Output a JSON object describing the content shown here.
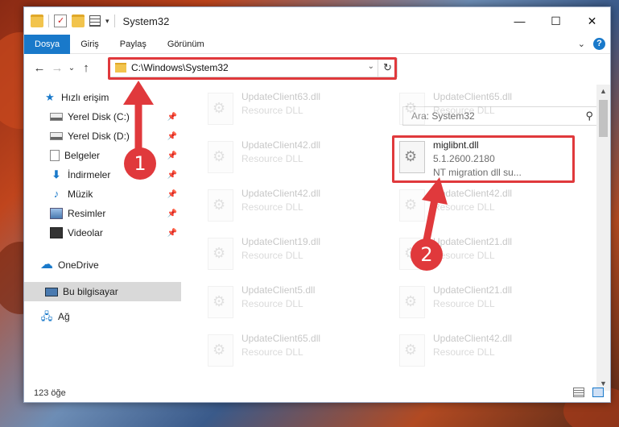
{
  "window": {
    "title": "System32",
    "controls": {
      "minimize": "—",
      "maximize": "☐",
      "close": "✕"
    }
  },
  "ribbon": {
    "tabs": [
      "Dosya",
      "Giriş",
      "Paylaş",
      "Görünüm"
    ],
    "active_tab": "Dosya",
    "collapse_icon": "chevron-down-icon",
    "help_label": "?"
  },
  "nav": {
    "back": "←",
    "forward": "→",
    "history": "⌄",
    "up": "↑",
    "address": "C:\\Windows\\System32",
    "refresh": "↻",
    "address_dropdown": "⌄",
    "search_placeholder": "Ara: System32",
    "search_icon": "⚲"
  },
  "sidebar": {
    "items": [
      {
        "label": "Hızlı erişim",
        "icon": "star-icon",
        "glyph": "★",
        "pinned": false
      },
      {
        "label": "Yerel Disk (C:)",
        "icon": "drive-icon",
        "glyph": "",
        "pinned": true
      },
      {
        "label": "Yerel Disk (D:)",
        "icon": "drive-icon",
        "glyph": "",
        "pinned": true
      },
      {
        "label": "Belgeler",
        "icon": "documents-icon",
        "glyph": "",
        "pinned": true
      },
      {
        "label": "İndirmeler",
        "icon": "download-icon",
        "glyph": "⬇",
        "pinned": true
      },
      {
        "label": "Müzik",
        "icon": "music-icon",
        "glyph": "♪",
        "pinned": true
      },
      {
        "label": "Resimler",
        "icon": "pictures-icon",
        "glyph": "",
        "pinned": true
      },
      {
        "label": "Videolar",
        "icon": "videos-icon",
        "glyph": "",
        "pinned": true
      },
      {
        "label": "OneDrive",
        "icon": "cloud-icon",
        "glyph": "☁",
        "pinned": false
      },
      {
        "label": "Bu bilgisayar",
        "icon": "computer-icon",
        "glyph": "",
        "pinned": false,
        "selected": true
      },
      {
        "label": "Ağ",
        "icon": "network-icon",
        "glyph": "🖧",
        "pinned": false
      }
    ],
    "pin_glyph": "📌"
  },
  "files": [
    {
      "name": "UpdateClient63.dll",
      "line2": "Resource DLL",
      "line3": "",
      "faded": true
    },
    {
      "name": "UpdateClient65.dll",
      "line2": "Resource DLL",
      "line3": "",
      "faded": true
    },
    {
      "name": "UpdateClient42.dll",
      "line2": "Resource DLL",
      "line3": "",
      "faded": true
    },
    {
      "name": "miglibnt.dll",
      "line2": "5.1.2600.2180",
      "line3": "NT migration dll su...",
      "faded": false
    },
    {
      "name": "UpdateClient42.dll",
      "line2": "Resource DLL",
      "line3": "",
      "faded": true
    },
    {
      "name": "UpdateClient42.dll",
      "line2": "Resource DLL",
      "line3": "",
      "faded": true
    },
    {
      "name": "UpdateClient19.dll",
      "line2": "Resource DLL",
      "line3": "",
      "faded": true
    },
    {
      "name": "UpdateClient21.dll",
      "line2": "Resource DLL",
      "line3": "",
      "faded": true
    },
    {
      "name": "UpdateClient5.dll",
      "line2": "Resource DLL",
      "line3": "",
      "faded": true
    },
    {
      "name": "UpdateClient21.dll",
      "line2": "Resource DLL",
      "line3": "",
      "faded": true
    },
    {
      "name": "UpdateClient65.dll",
      "line2": "Resource DLL",
      "line3": "",
      "faded": true
    },
    {
      "name": "UpdateClient42.dll",
      "line2": "Resource DLL",
      "line3": "",
      "faded": true
    }
  ],
  "status": {
    "item_count": "123 öğe"
  },
  "annotations": {
    "step1": "1",
    "step2": "2",
    "color": "#e0393c"
  }
}
